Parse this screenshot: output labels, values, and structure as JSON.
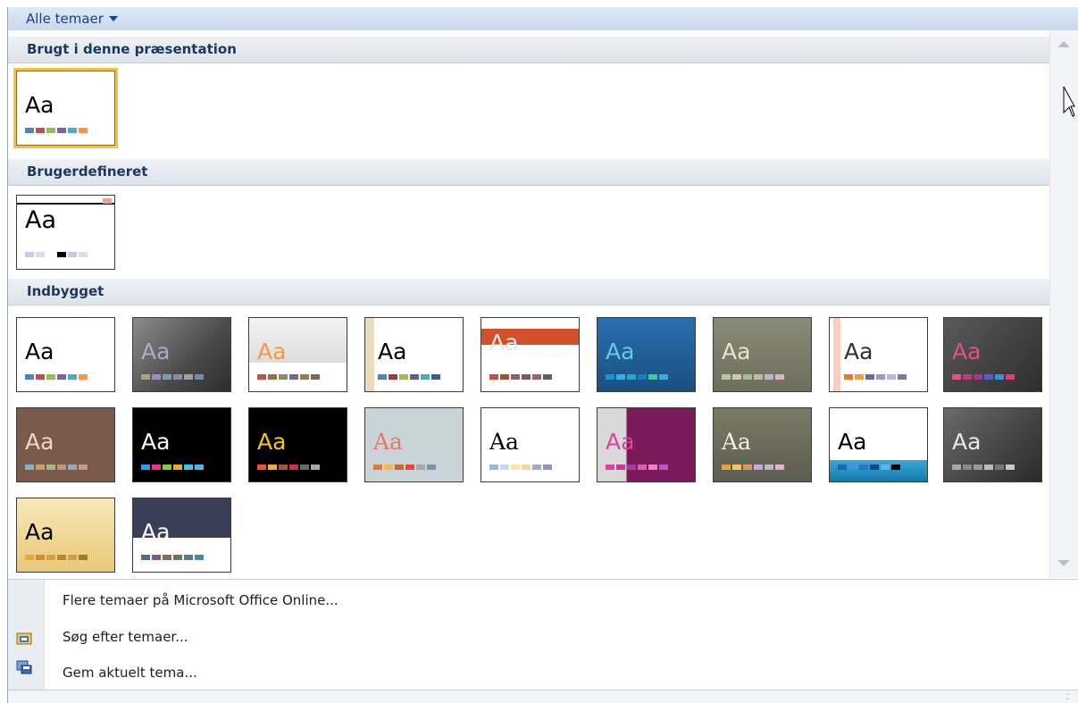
{
  "dropdown": {
    "label": "Alle temaer"
  },
  "sections": {
    "used": "Brugt i denne præsentation",
    "custom": "Brugerdefineret",
    "builtin": "Indbygget"
  },
  "theme_sample_text": "Aa",
  "menu": {
    "more_online": "Flere temaer på Microsoft Office Online...",
    "browse": "Søg efter temaer...",
    "save_current": "Gem aktuelt tema..."
  },
  "icons": {
    "dropdown": "chevron-down-icon",
    "scroll_up": "scroll-up-arrow-icon",
    "scroll_down": "scroll-down-arrow-icon",
    "browse": "folder-browse-icon",
    "save": "save-theme-icon",
    "cursor": "mouse-cursor-icon",
    "grip": "resize-grip-icon"
  },
  "colors": {
    "header_text": "#15428b",
    "selection": "#f6c142"
  }
}
